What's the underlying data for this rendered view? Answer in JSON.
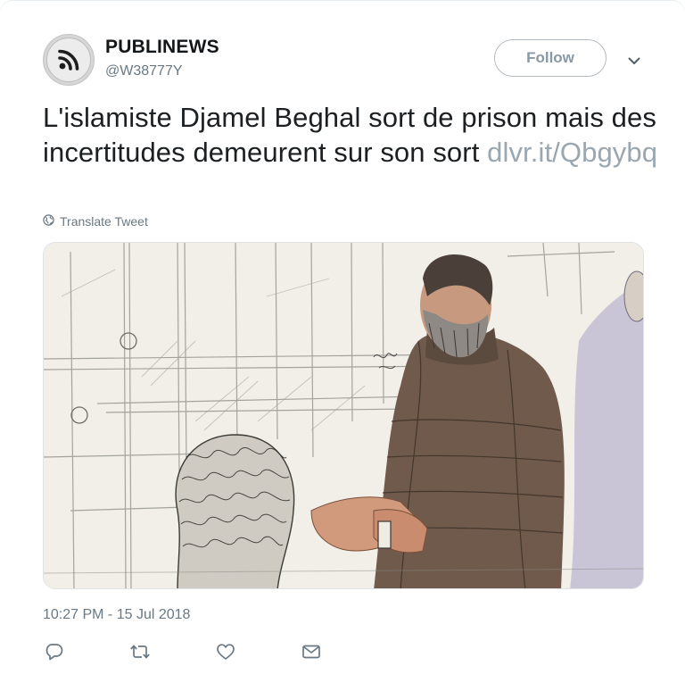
{
  "account": {
    "name": "PUBLINEWS",
    "handle": "@W38777Y",
    "avatar_icon": "rss-icon"
  },
  "follow": {
    "label": "Follow"
  },
  "menu": {
    "icon": "chevron-down-icon"
  },
  "tweet": {
    "text": "L'islamiste Djamel Beghal sort de prison mais des incertitudes demeurent sur son sort ",
    "link": "dlvr.it/Qbgybq"
  },
  "translate": {
    "label": "Translate Tweet",
    "icon": "globe-icon"
  },
  "meta": {
    "timestamp": "10:27 PM - 15 Jul 2018"
  },
  "actions": [
    {
      "name": "reply",
      "icon": "reply-icon"
    },
    {
      "name": "retweet",
      "icon": "retweet-icon"
    },
    {
      "name": "like",
      "icon": "heart-icon"
    },
    {
      "name": "message",
      "icon": "envelope-icon"
    }
  ],
  "colors": {
    "text": "#1c2022",
    "muted": "#697882",
    "link": "#9aa7b0",
    "border": "#b5bcc1"
  }
}
